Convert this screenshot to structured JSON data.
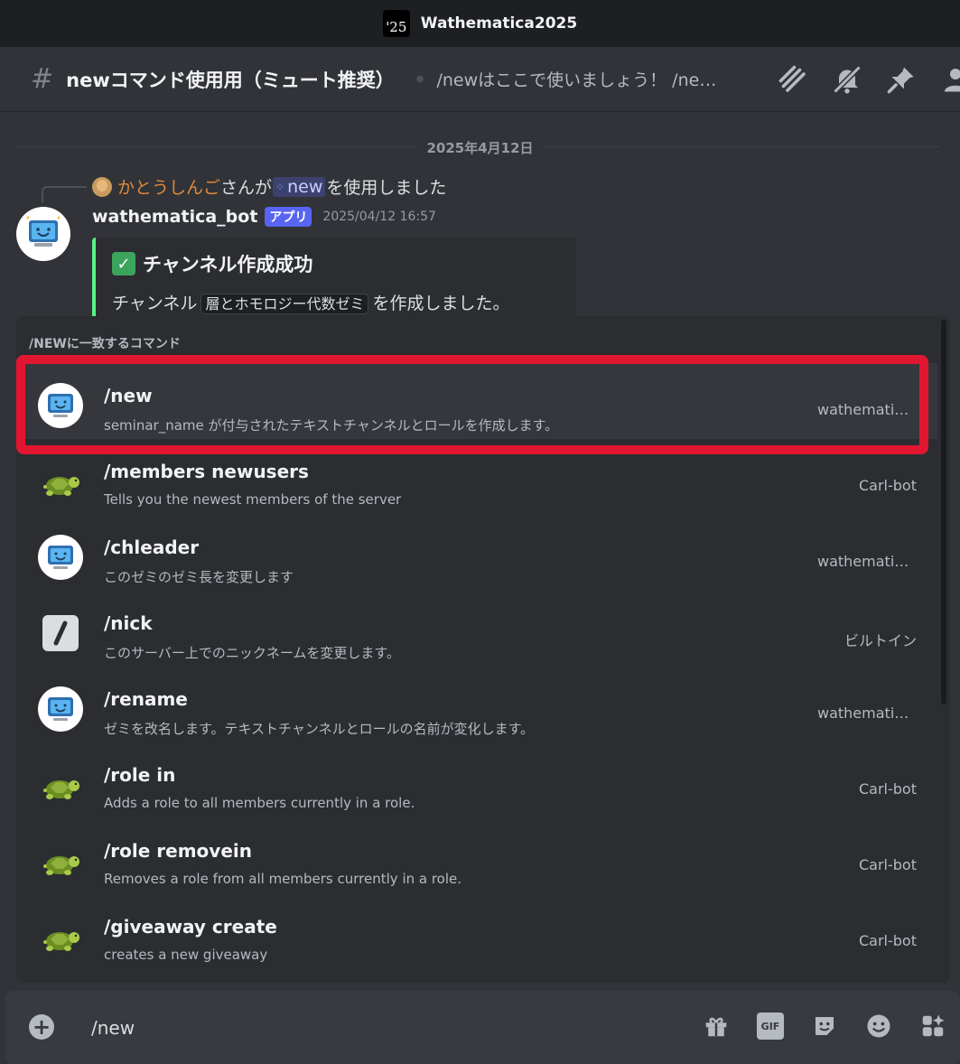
{
  "titlebar": {
    "server_logo_text": "'25",
    "server_name": "Wathematica2025"
  },
  "header": {
    "channel_name": "newコマンド使用用（ミュート推奨）",
    "topic": "/newはここで使いましょう！ /newで作成したチャンネルは",
    "icons": [
      "threads-icon",
      "bell-muted-icon",
      "pin-icon",
      "members-icon"
    ]
  },
  "chat": {
    "date_divider": "2025年4月12日",
    "reply": {
      "user": "かとうしんご",
      "before": "さんが",
      "command": "new",
      "after": "を使用しました"
    },
    "message": {
      "author": "wathematica_bot",
      "badge": "アプリ",
      "timestamp": "2025/04/12 16:57",
      "embed": {
        "title": "チャンネル作成成功",
        "desc_before": "チャンネル",
        "desc_code": "層とホモロジー代数ゼミ",
        "desc_after": "を作成しました。"
      }
    }
  },
  "autocomplete": {
    "title": "/NEWに一致するコマンド",
    "commands": [
      {
        "name": "/new",
        "desc": "seminar_name が付与されたテキストチャンネルとロールを作成します。",
        "app": "wathematica_bot",
        "icon": "bot-avatar-icon",
        "selected": true
      },
      {
        "name": "/members newusers",
        "desc": "Tells you the newest members of the server",
        "app": "Carl-bot",
        "icon": "turtle-icon"
      },
      {
        "name": "/chleader",
        "desc": "このゼミのゼミ長を変更します",
        "app": "wathematica_bot",
        "icon": "bot-avatar-icon"
      },
      {
        "name": "/nick",
        "desc": "このサーバー上でのニックネームを変更します。",
        "app": "ビルトイン",
        "icon": "slash-icon"
      },
      {
        "name": "/rename",
        "desc": "ゼミを改名します。テキストチャンネルとロールの名前が変化します。",
        "app": "wathematica_bot",
        "icon": "bot-avatar-icon"
      },
      {
        "name": "/role in",
        "desc": "Adds a role to all members currently in a role.",
        "app": "Carl-bot",
        "icon": "turtle-icon"
      },
      {
        "name": "/role removein",
        "desc": "Removes a role from all members currently in a role.",
        "app": "Carl-bot",
        "icon": "turtle-icon"
      },
      {
        "name": "/giveaway create",
        "desc": "creates a new giveaway",
        "app": "Carl-bot",
        "icon": "turtle-icon"
      }
    ]
  },
  "composer": {
    "value": "/new",
    "gif_label": "GIF",
    "icons": [
      "plus-circle-icon",
      "gift-icon",
      "gif-icon",
      "sticker-icon",
      "emoji-icon",
      "apps-icon"
    ]
  },
  "colors": {
    "accent": "#5865f2",
    "highlight": "#e21630",
    "embed_bar": "#57f287",
    "background": "#313338"
  }
}
